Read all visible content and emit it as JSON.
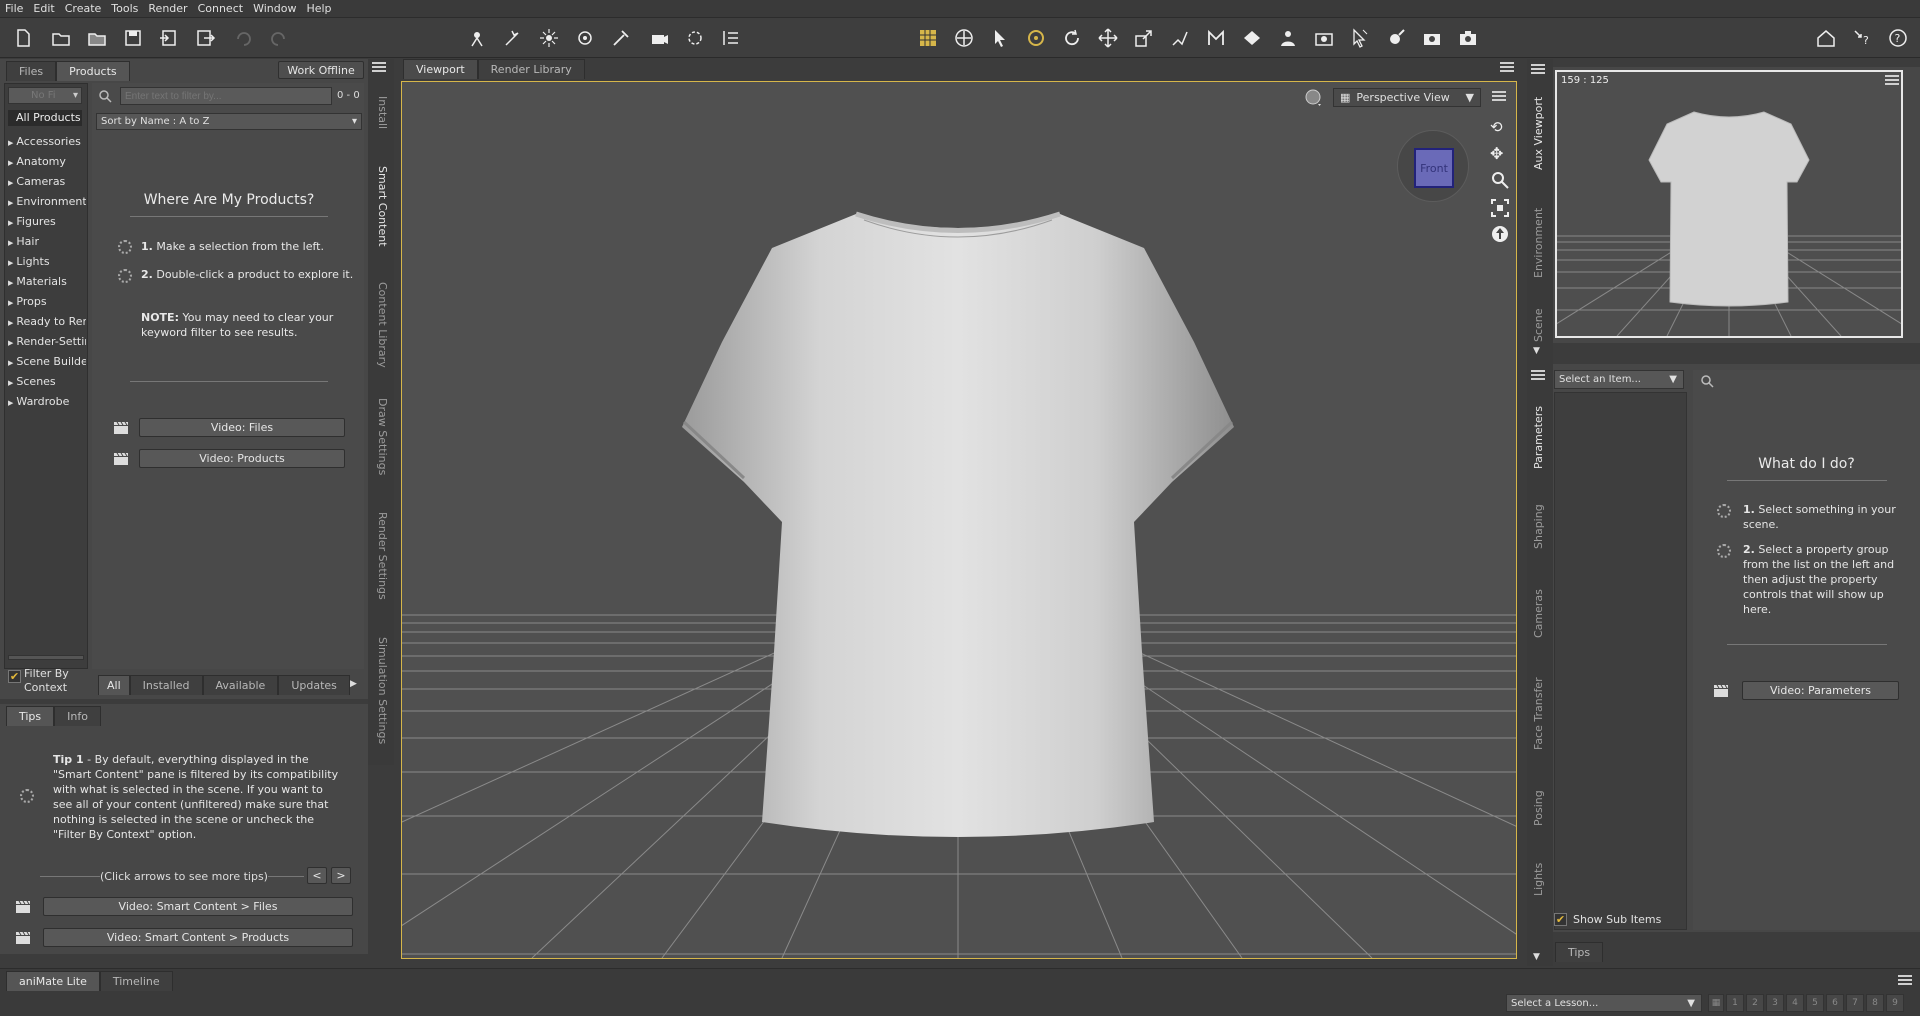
{
  "menu": [
    "File",
    "Edit",
    "Create",
    "Tools",
    "Render",
    "Connect",
    "Window",
    "Help"
  ],
  "left": {
    "tabs": [
      "Files",
      "Products"
    ],
    "work_offline": "Work Offline",
    "search_placeholder": "Enter text to filter by...",
    "count": "0 - 0",
    "sort": "Sort by Name : A to Z",
    "all_products": "All Products",
    "filter_truncated": "No Fi",
    "categories": [
      "Accessories",
      "Anatomy",
      "Cameras",
      "Environments",
      "Figures",
      "Hair",
      "Lights",
      "Materials",
      "Props",
      "Ready to Rend",
      "Render-Settin",
      "Scene Builder",
      "Scenes",
      "Wardrobe"
    ],
    "heading": "Where Are My Products?",
    "step1_num": "1.",
    "step1": "Make a selection from the left.",
    "step2_num": "2.",
    "step2": "Double-click a product to explore it.",
    "note_label": "NOTE:",
    "note": "You may need to clear your keyword filter to see results.",
    "video_files": "Video: Files",
    "video_products": "Video: Products",
    "filter_by_context": "Filter By Context",
    "bottom_tabs": [
      "All",
      "Installed",
      "Available",
      "Updates"
    ],
    "vtabs": [
      "Install",
      "Smart Content",
      "Content Library",
      "Draw Settings",
      "Render Settings",
      "Simulation Settings"
    ]
  },
  "tips": {
    "tabs": [
      "Tips",
      "Info"
    ],
    "tip_label": "Tip 1",
    "tip_text": " - By default, everything displayed in the \"Smart Content\" pane is filtered by its compatibility with what is selected in the scene. If you want to see all of your content (unfiltered) make sure that nothing is selected in the scene or uncheck the \"Filter By Context\" option.",
    "more": "(Click arrows to see more tips)",
    "prev": "<",
    "next": ">",
    "video1": "Video: Smart Content > Files",
    "video2": "Video: Smart Content > Products"
  },
  "viewport": {
    "tabs": [
      "Viewport",
      "Render Library"
    ],
    "view": "Perspective View",
    "cube": "Front"
  },
  "right": {
    "aux_ratio": "159 : 125",
    "vtabs_top": [
      "Aux Viewport",
      "Environment",
      "Scene"
    ],
    "select_item": "Select an Item...",
    "heading": "What do I do?",
    "step1_num": "1.",
    "step1": "Select something in your scene.",
    "step2_num": "2.",
    "step2": "Select a property group from the list on the left and then adjust the property controls that will show up here.",
    "video": "Video: Parameters",
    "show_sub": "Show Sub Items",
    "tips_tab": "Tips",
    "vtabs": [
      "Parameters",
      "Shaping",
      "Cameras",
      "Face Transfer",
      "Posing",
      "Lights"
    ]
  },
  "bottom": {
    "tabs": [
      "aniMate Lite",
      "Timeline"
    ],
    "lesson": "Select a Lesson...",
    "pages": [
      "1",
      "2",
      "3",
      "4",
      "5",
      "6",
      "7",
      "8",
      "9"
    ]
  },
  "colors": {
    "accent": "#d6b64a",
    "bg": "#3c3c3c",
    "panel": "#474747",
    "viewport": "#505050"
  }
}
